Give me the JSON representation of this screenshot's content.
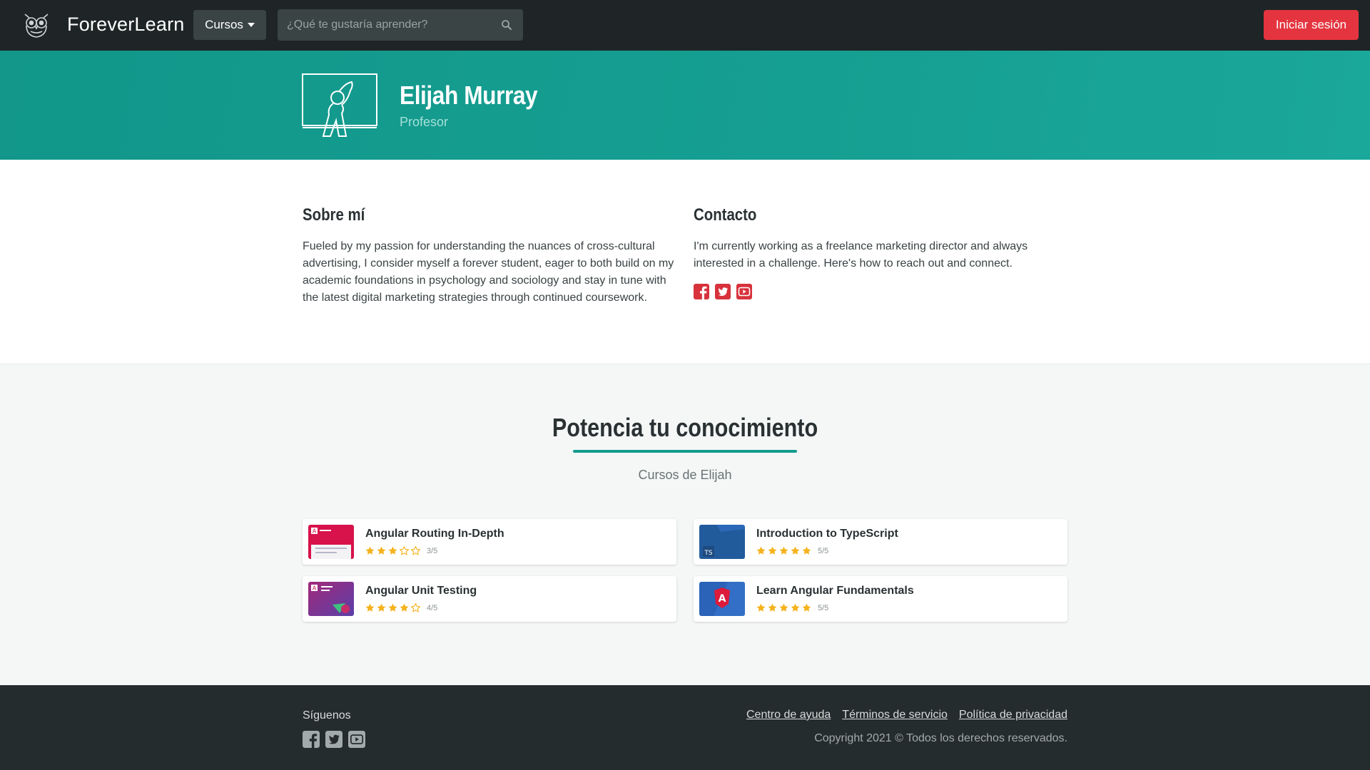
{
  "navbar": {
    "brand": "ForeverLearn",
    "courses_label": "Cursos",
    "search_placeholder": "¿Qué te gustaría aprender?",
    "login_label": "Iniciar sesión"
  },
  "profile": {
    "name": "Elijah Murray",
    "role": "Profesor"
  },
  "about": {
    "title": "Sobre mí",
    "text": "Fueled by my passion for understanding the nuances of cross-cultural advertising, I consider myself a forever student, eager to both build on my academic foundations in psychology and sociology and stay in tune with the latest digital marketing strategies through continued coursework."
  },
  "contact": {
    "title": "Contacto",
    "text": "I'm currently working as a freelance marketing director and always interested in a challenge. Here's how to reach out and connect.",
    "social": [
      "facebook-icon",
      "twitter-icon",
      "youtube-icon"
    ]
  },
  "courses_section": {
    "title": "Potencia tu conocimiento",
    "subtitle": "Cursos de Elijah",
    "courses": [
      {
        "title": "Angular Routing In-Depth",
        "rating": 3,
        "rating_text": "3/5",
        "thumb": "angular-routing"
      },
      {
        "title": "Introduction to TypeScript",
        "rating": 5,
        "rating_text": "5/5",
        "thumb": "typescript"
      },
      {
        "title": "Angular Unit Testing",
        "rating": 4,
        "rating_text": "4/5",
        "thumb": "angular-testing"
      },
      {
        "title": "Learn Angular Fundamentals",
        "rating": 5,
        "rating_text": "5/5",
        "thumb": "angular-fundamentals"
      }
    ]
  },
  "footer": {
    "follow_label": "Síguenos",
    "links": [
      "Centro de ayuda",
      "Términos de servicio",
      "Política de privacidad"
    ],
    "copyright": "Copyright 2021 © Todos los derechos reservados."
  },
  "colors": {
    "navbar": "#1f2526",
    "hero": "#12978a",
    "accent": "#139b8e",
    "login": "#e4343f",
    "social": "#d8323c",
    "star": "#f5b21c",
    "footer": "#252c2d"
  }
}
